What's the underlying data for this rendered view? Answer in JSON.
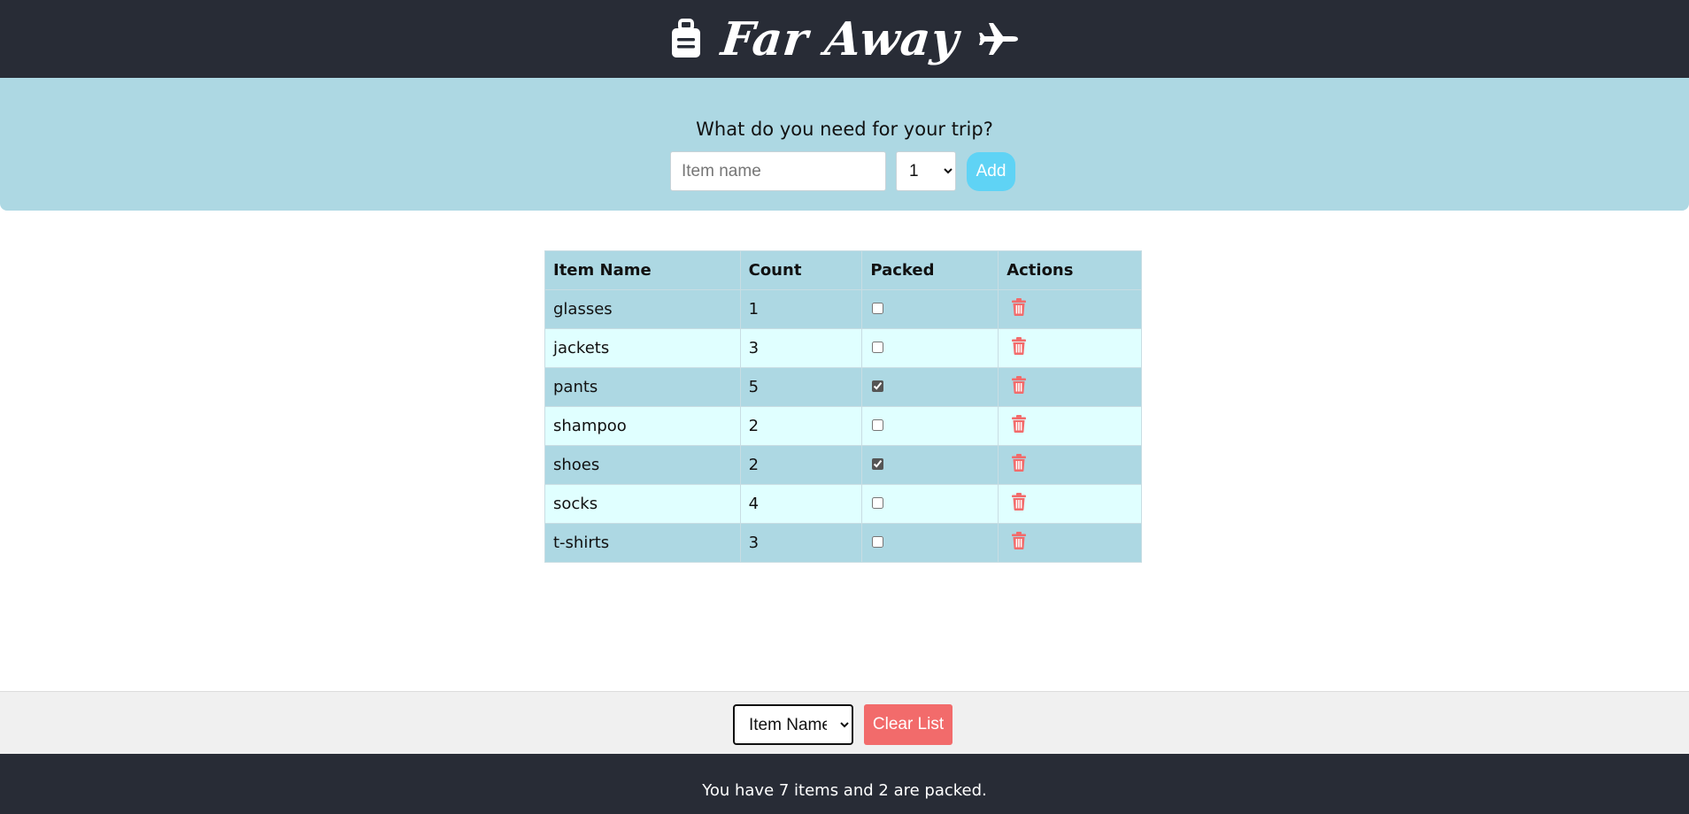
{
  "header": {
    "title": "Far Away",
    "left_icon": "suitcase-icon",
    "right_icon": "airplane-icon"
  },
  "add_form": {
    "question": "What do you need for your trip?",
    "item_placeholder": "Item name",
    "item_value": "",
    "quantity_selected": "1",
    "add_label": "Add"
  },
  "table": {
    "headers": [
      "Item Name",
      "Count",
      "Packed",
      "Actions"
    ],
    "rows": [
      {
        "name": "glasses",
        "count": "1",
        "packed": false
      },
      {
        "name": "jackets",
        "count": "3",
        "packed": false
      },
      {
        "name": "pants",
        "count": "5",
        "packed": true
      },
      {
        "name": "shampoo",
        "count": "2",
        "packed": false
      },
      {
        "name": "shoes",
        "count": "2",
        "packed": true
      },
      {
        "name": "socks",
        "count": "4",
        "packed": false
      },
      {
        "name": "t-shirts",
        "count": "3",
        "packed": false
      }
    ],
    "delete_icon": "trash-icon"
  },
  "sort_bar": {
    "sort_selected": "Item Name",
    "clear_label": "Clear List"
  },
  "footer": {
    "stats": "You have 7 items and 2 are packed."
  },
  "colors": {
    "dark": "#282c36",
    "light_blue": "#add8e3",
    "light_cyan": "#e0ffff",
    "accent_blue": "#5fd3f5",
    "danger": "#f26b6b"
  }
}
